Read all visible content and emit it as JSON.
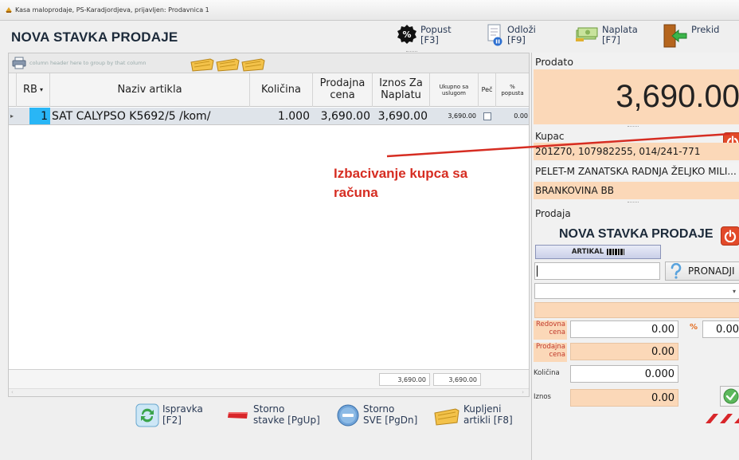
{
  "window": {
    "title": "Kasa maloprodaje, PS-Karadjordjeva, prijavljen: Prodavnica 1"
  },
  "toolbar": {
    "page_title": "NOVA STAVKA PRODAJE",
    "popust_label": "Popust",
    "popust_key": "[F3]",
    "odlozi_label": "Odloži",
    "odlozi_key": "[F9]",
    "naplata_label": "Naplata",
    "naplata_key": "[F7]",
    "prekid_label": "Prekid"
  },
  "grid": {
    "group_hint": "column header here to group by that column",
    "columns": {
      "rb": "RB",
      "naziv": "Naziv artikla",
      "kolicina": "Količina",
      "prodajna_cena": "Prodajna cena",
      "iznos_za_naplatu": "Iznos Za Naplatu",
      "ukupno_sa_uslugom": "Ukupno sa uslugom",
      "pec": "Peč",
      "pct_popusta": "% popusta"
    },
    "rows": [
      {
        "rb": "1",
        "naziv": "SAT CALYPSO K5692/5 /kom/",
        "kolicina": "1.000",
        "prodajna_cena": "3,690.00",
        "iznos_za_naplatu": "3,690.00",
        "ukupno_sa_uslugom": "3,690.00",
        "pct_popusta": "0.00"
      }
    ],
    "totals": {
      "iznos": "3,690.00",
      "ukupno": "3,690.00"
    }
  },
  "bottom_buttons": {
    "ispravka": "Ispravka",
    "ispravka_key": "[F2]",
    "storno_stavke": "Storno",
    "storno_stavke_key": "stavke [PgUp]",
    "storno_sve": "Storno",
    "storno_sve_key": "SVE [PgDn]",
    "kupljeni": "Kupljeni",
    "kupljeni_key": "artikli [F8]"
  },
  "right_panel": {
    "prodato_title": "Prodato",
    "prodato_total": "3,690.00",
    "kupac_title": "Kupac",
    "kupac_line1": "201Z70, 107982255, 014/241-771",
    "kupac_line2": "PELET-M ZANATSKA RADNJA ŽELJKO MILI...",
    "kupac_line3": "BRANKOVINA BB",
    "prodaja_title": "Prodaja",
    "prodaja_heading": "NOVA STAVKA PRODAJE",
    "artikal_button": "ARTIKAL",
    "pronadji_label": "PRONADJI",
    "redovna_cena_label": "Redovna cena",
    "redovna_cena_value": "0.00",
    "pct_value": "0.00",
    "pct_symbol": "%",
    "prodajna_cena_label": "Prodajna cena",
    "prodajna_cena_value": "0.00",
    "kolicina_label": "Količina",
    "kolicina_value": "0.000",
    "iznos_label": "Iznos",
    "iznos_value": "0.00"
  },
  "annotation": {
    "text_line1": "Izbacivanje kupca sa",
    "text_line2": "računa",
    "color": "#d62d22"
  },
  "colors": {
    "accent_peach": "#fbd8b8",
    "selected_rb": "#29b6f6",
    "power_red": "#e24a2a"
  }
}
